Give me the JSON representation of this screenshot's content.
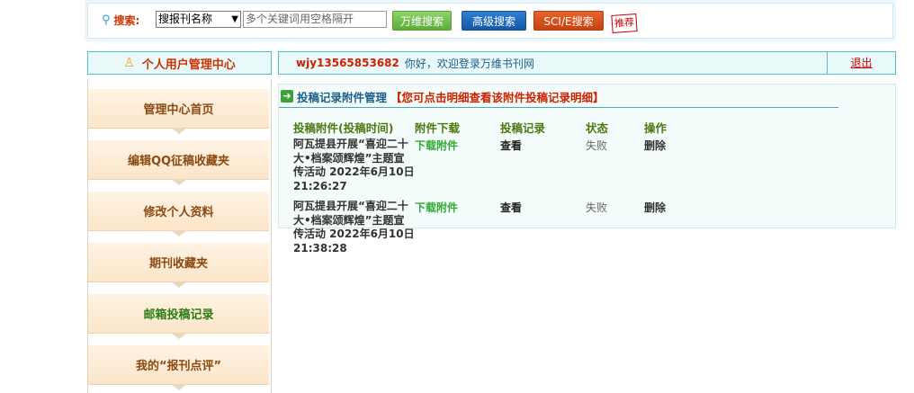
{
  "search": {
    "label": "搜索:",
    "select_value": "搜报刊名称",
    "placeholder": "多个关键词用空格隔开",
    "btn_wanwei": "万维搜索",
    "btn_advanced": "高级搜索",
    "btn_sci": "SCI/E搜索",
    "recommend": "推荐"
  },
  "user_center": {
    "title": "个人用户管理中心",
    "username": "wjy13565853682",
    "greeting": "你好，欢迎登录万维书刊网",
    "logout": "退出"
  },
  "sidebar": {
    "items": [
      {
        "label": "管理中心首页"
      },
      {
        "label": "编辑QQ征稿收藏夹"
      },
      {
        "label": "修改个人资料"
      },
      {
        "label": "期刊收藏夹"
      },
      {
        "label": "邮箱投稿记录"
      },
      {
        "label": "我的“报刊点评”"
      }
    ]
  },
  "panel": {
    "title": "投稿记录附件管理",
    "hint": "【您可点击明细查看该附件投稿记录明细】",
    "columns": [
      "投稿附件(投稿时间)",
      "附件下载",
      "投稿记录",
      "状态",
      "操作"
    ],
    "rows": [
      {
        "name": "阿瓦提县开展“喜迎二十大•档案颂辉煌”主题宣传活动 2022年6月10日21:26:27",
        "download": "下载附件",
        "record": "查看",
        "status": "失败",
        "action": "删除"
      },
      {
        "name": "阿瓦提县开展“喜迎二十大•档案颂辉煌”主题宣传活动 2022年6月10日21:38:28",
        "download": "下载附件",
        "record": "查看",
        "status": "失败",
        "action": "删除"
      }
    ]
  },
  "colors": {
    "accent_red": "#cc2200",
    "accent_green": "#33aa33",
    "border_teal": "#4dc1c7"
  }
}
